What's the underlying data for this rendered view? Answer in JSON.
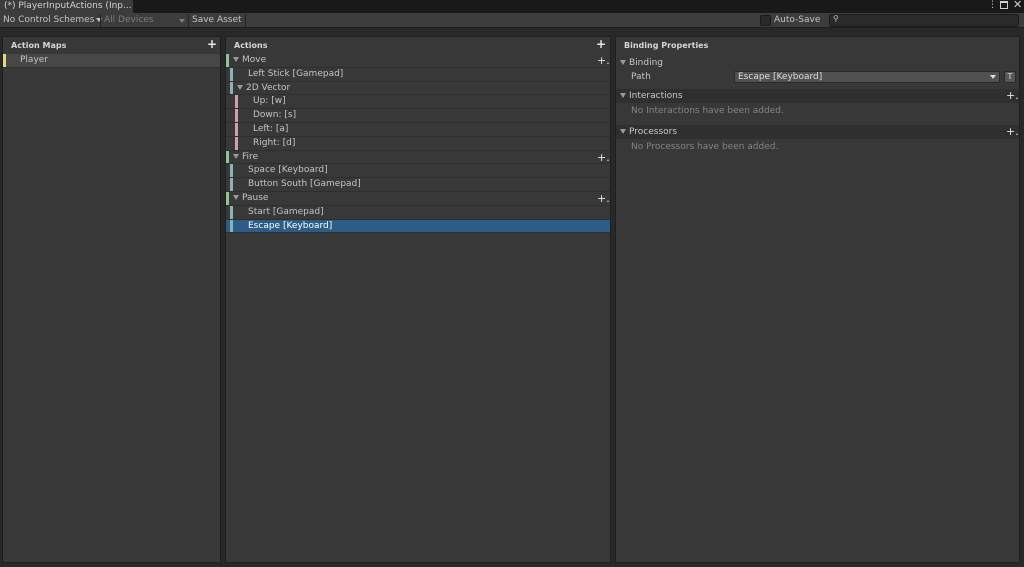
{
  "tab": {
    "title": "(*) PlayerInputActions (Inp..."
  },
  "toolbar": {
    "control_schemes": "No Control Schemes",
    "devices": "All Devices",
    "save_asset": "Save Asset",
    "auto_save": "Auto-Save",
    "search_placeholder": ""
  },
  "action_maps": {
    "header": "Action Maps",
    "items": [
      {
        "label": "Player",
        "color": "#e8d77a"
      }
    ]
  },
  "actions": {
    "header": "Actions",
    "rows": [
      {
        "label": "Move",
        "kind": "action",
        "color": "#8fc58f"
      },
      {
        "label": "Left Stick [Gamepad]",
        "kind": "binding",
        "color": "#8ab3b8"
      },
      {
        "label": "2D Vector",
        "kind": "composite",
        "color": "#8ab3b8"
      },
      {
        "label": "Up:  [w]",
        "kind": "part",
        "color": "#cfa0b3"
      },
      {
        "label": "Down:  [s]",
        "kind": "part",
        "color": "#cfa0b3"
      },
      {
        "label": "Left:  [a]",
        "kind": "part",
        "color": "#cfa0b3"
      },
      {
        "label": "Right:  [d]",
        "kind": "part",
        "color": "#cfa0b3"
      },
      {
        "label": "Fire",
        "kind": "action",
        "color": "#8fc58f"
      },
      {
        "label": "Space [Keyboard]",
        "kind": "binding",
        "color": "#8ab3b8"
      },
      {
        "label": "Button South [Gamepad]",
        "kind": "binding",
        "color": "#8ab3b8"
      },
      {
        "label": "Pause",
        "kind": "action",
        "color": "#8fc58f"
      },
      {
        "label": "Start [Gamepad]",
        "kind": "binding",
        "color": "#8ab3b8"
      },
      {
        "label": "Escape [Keyboard]",
        "kind": "binding",
        "color": "#8ab3b8",
        "selected": true
      }
    ]
  },
  "properties": {
    "header": "Binding Properties",
    "binding_section": "Binding",
    "path_label": "Path",
    "path_value": "Escape [Keyboard]",
    "t_button": "T",
    "interactions_section": "Interactions",
    "interactions_empty": "No Interactions have been added.",
    "processors_section": "Processors",
    "processors_empty": "No Processors have been added."
  },
  "colors": {
    "selection": "#2c5d87",
    "action_bar": "#8fc58f",
    "binding_bar": "#8ab3b8",
    "part_bar": "#cfa0b3",
    "map_bar": "#e8d77a"
  }
}
